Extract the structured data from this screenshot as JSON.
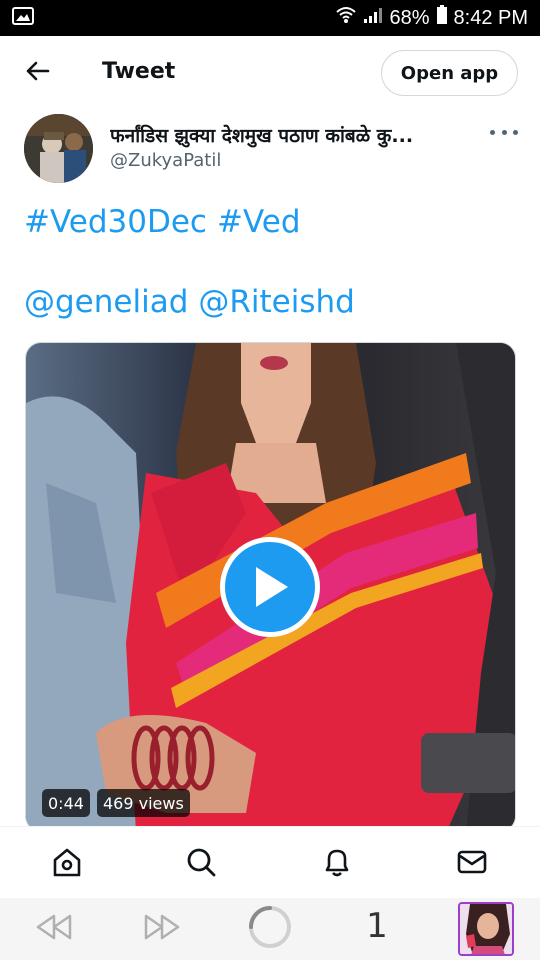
{
  "status_bar": {
    "battery": "68%",
    "time": "8:42 PM",
    "icons": [
      "image-icon",
      "wifi-icon",
      "signal-icon",
      "battery-icon"
    ]
  },
  "header": {
    "title": "Tweet",
    "open_app_label": "Open app",
    "back_icon": "arrow-left-icon"
  },
  "author": {
    "name": "फर्नांडिस झुक्या देशमुख पठाण कांबळे कु...",
    "handle": "@ZukyaPatil"
  },
  "tweet": {
    "hashtags": [
      "#Ved30Dec",
      "#Ved"
    ],
    "mentions": [
      "@geneliad",
      "@Riteishd"
    ]
  },
  "media": {
    "duration": "0:44",
    "views": "469 views",
    "play_icon": "play-icon"
  },
  "bottom_nav": {
    "items": [
      "home-icon",
      "search-icon",
      "notifications-icon",
      "messages-icon"
    ]
  },
  "browser_bar": {
    "tab_count": "1",
    "items": [
      "rewind-icon",
      "fast-forward-icon",
      "loading-icon",
      "tab-count",
      "profile-thumbnail"
    ]
  },
  "colors": {
    "accent": "#1d9bf0",
    "text": "#0f1419",
    "muted": "#536471",
    "border": "#cfd9de"
  }
}
